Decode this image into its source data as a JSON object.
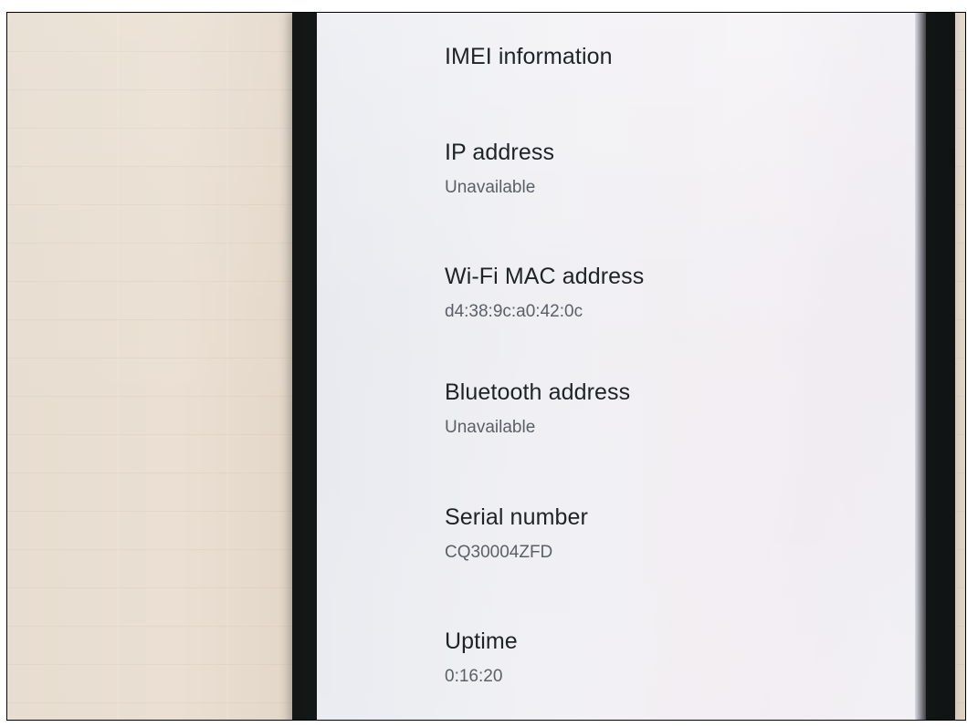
{
  "device_info": {
    "items": [
      {
        "title": "IMEI information",
        "value": ""
      },
      {
        "title": "IP address",
        "value": "Unavailable"
      },
      {
        "title": "Wi-Fi MAC address",
        "value": "d4:38:9c:a0:42:0c"
      },
      {
        "title": "Bluetooth address",
        "value": "Unavailable"
      },
      {
        "title": "Serial number",
        "value": "CQ30004ZFD"
      },
      {
        "title": "Uptime",
        "value": "0:16:20"
      }
    ]
  }
}
